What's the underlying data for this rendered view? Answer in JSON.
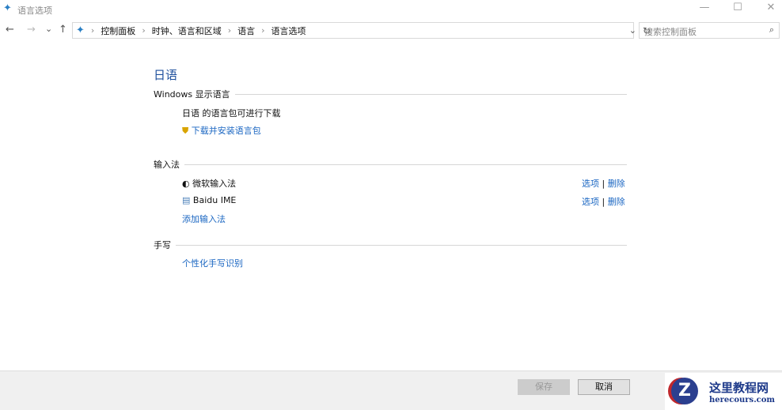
{
  "window": {
    "title": "语言选项",
    "minimize": "—",
    "maximize": "☐",
    "close": "✕"
  },
  "nav": {
    "back": "←",
    "forward": "→",
    "recent": "⌄",
    "up": "↑"
  },
  "breadcrumb": [
    "控制面板",
    "时钟、语言和区域",
    "语言",
    "语言选项"
  ],
  "search": {
    "placeholder": "搜索控制面板"
  },
  "language": {
    "title": "日语",
    "display_section": "Windows 显示语言",
    "pack_status": "日语 的语言包可进行下载",
    "download_link": "下载并安装语言包",
    "input_section": "输入法",
    "input_methods": [
      {
        "name": "微软输入法",
        "options": "选项",
        "remove": "删除"
      },
      {
        "name": "Baidu IME",
        "options": "选项",
        "remove": "删除"
      }
    ],
    "add_input": "添加输入法",
    "handwriting_section": "手写",
    "handwriting_link": "个性化手写识别"
  },
  "footer": {
    "save": "保存",
    "cancel": "取消"
  },
  "watermark": {
    "title": "这里教程网",
    "url": "herecours.com"
  }
}
